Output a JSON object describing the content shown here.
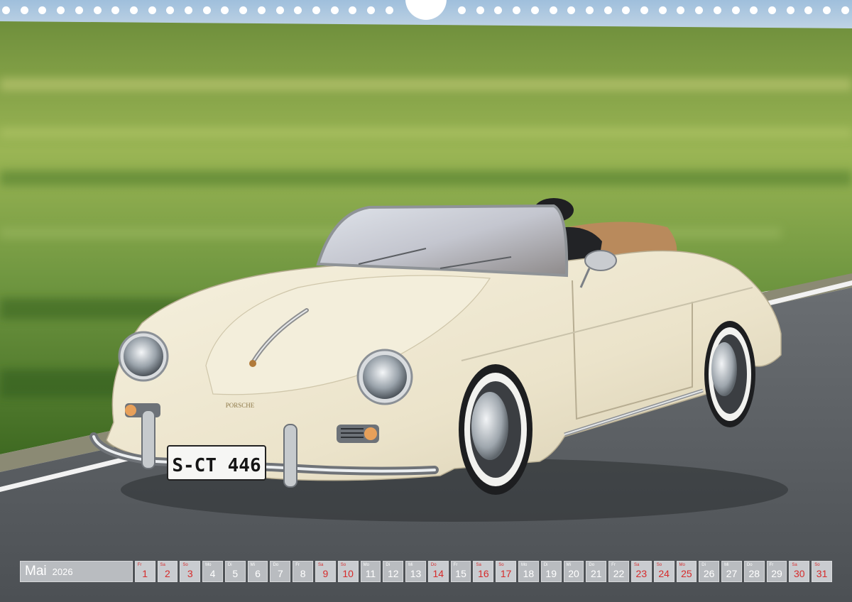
{
  "plate_text": "S-CT 446",
  "badge_text": "PORSCHE",
  "calendar": {
    "month": "Mai",
    "year": "2026",
    "days": [
      {
        "num": "1",
        "wd": "Fr",
        "red": true
      },
      {
        "num": "2",
        "wd": "Sa",
        "red": true
      },
      {
        "num": "3",
        "wd": "So",
        "red": true
      },
      {
        "num": "4",
        "wd": "Mo",
        "red": false
      },
      {
        "num": "5",
        "wd": "Di",
        "red": false
      },
      {
        "num": "6",
        "wd": "Mi",
        "red": false
      },
      {
        "num": "7",
        "wd": "Do",
        "red": false
      },
      {
        "num": "8",
        "wd": "Fr",
        "red": false
      },
      {
        "num": "9",
        "wd": "Sa",
        "red": true
      },
      {
        "num": "10",
        "wd": "So",
        "red": true
      },
      {
        "num": "11",
        "wd": "Mo",
        "red": false
      },
      {
        "num": "12",
        "wd": "Di",
        "red": false
      },
      {
        "num": "13",
        "wd": "Mi",
        "red": false
      },
      {
        "num": "14",
        "wd": "Do",
        "red": true
      },
      {
        "num": "15",
        "wd": "Fr",
        "red": false
      },
      {
        "num": "16",
        "wd": "Sa",
        "red": true
      },
      {
        "num": "17",
        "wd": "So",
        "red": true
      },
      {
        "num": "18",
        "wd": "Mo",
        "red": false
      },
      {
        "num": "19",
        "wd": "Di",
        "red": false
      },
      {
        "num": "20",
        "wd": "Mi",
        "red": false
      },
      {
        "num": "21",
        "wd": "Do",
        "red": false
      },
      {
        "num": "22",
        "wd": "Fr",
        "red": false
      },
      {
        "num": "23",
        "wd": "Sa",
        "red": true
      },
      {
        "num": "24",
        "wd": "So",
        "red": true
      },
      {
        "num": "25",
        "wd": "Mo",
        "red": true
      },
      {
        "num": "26",
        "wd": "Di",
        "red": false
      },
      {
        "num": "27",
        "wd": "Mi",
        "red": false
      },
      {
        "num": "28",
        "wd": "Do",
        "red": false
      },
      {
        "num": "29",
        "wd": "Fr",
        "red": false
      },
      {
        "num": "30",
        "wd": "Sa",
        "red": true
      },
      {
        "num": "31",
        "wd": "So",
        "red": true
      }
    ]
  },
  "colors": {
    "sky": "#a9c6df",
    "grass_light": "#8fb04a",
    "grass_dark": "#3f6a22",
    "road": "#5b5f63",
    "car_body": "#ece5cf",
    "calendar_cell": "#b9bcc0",
    "holiday_red": "#d62b2b"
  }
}
